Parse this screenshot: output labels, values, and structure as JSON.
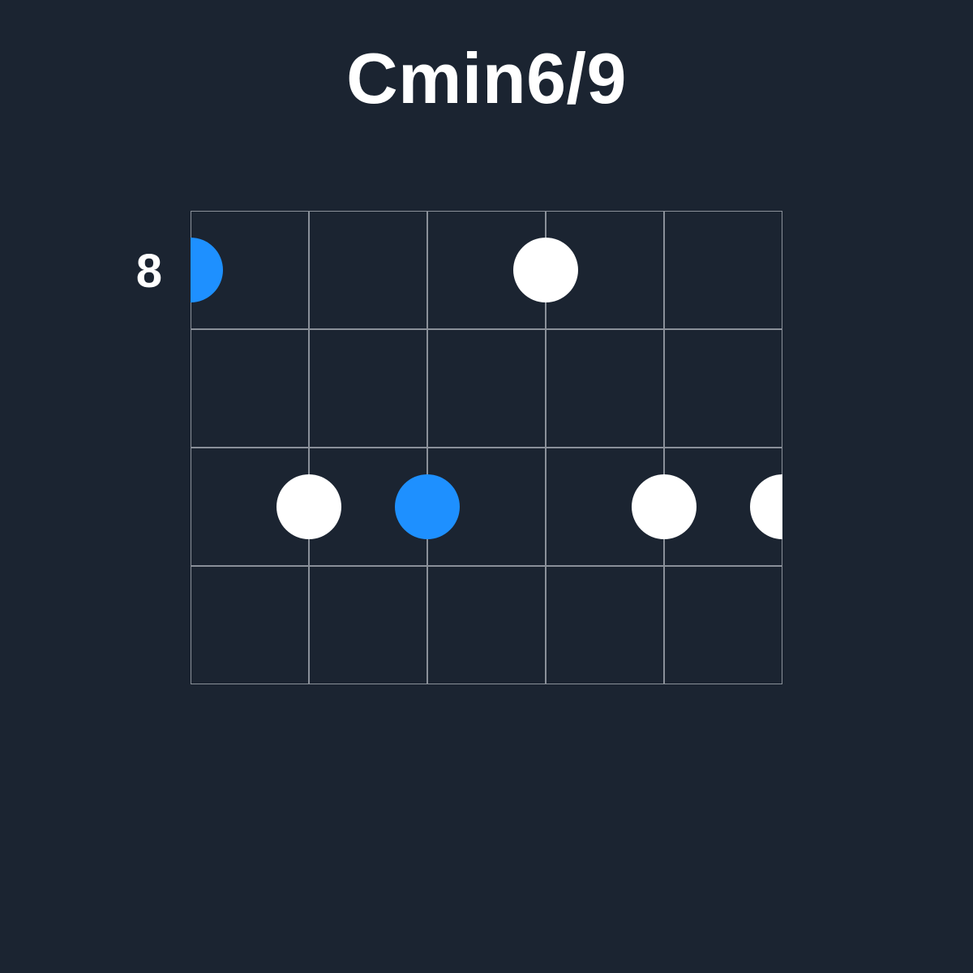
{
  "title": "Cmin6/9",
  "position_label": "8",
  "colors": {
    "background": "#1b2431",
    "grid": "#8a9099",
    "dot_root": "#1e90ff",
    "dot_note": "#ffffff",
    "text": "#ffffff"
  },
  "chart_data": {
    "type": "guitar-chord-diagram",
    "strings": 6,
    "frets_shown": 4,
    "starting_fret": 8,
    "notes": [
      {
        "string": 6,
        "fret": 1,
        "root": true
      },
      {
        "string": 5,
        "fret": 3,
        "root": false
      },
      {
        "string": 4,
        "fret": 3,
        "root": true
      },
      {
        "string": 3,
        "fret": 1,
        "root": false
      },
      {
        "string": 2,
        "fret": 3,
        "root": false
      },
      {
        "string": 1,
        "fret": 3,
        "root": false
      }
    ]
  }
}
